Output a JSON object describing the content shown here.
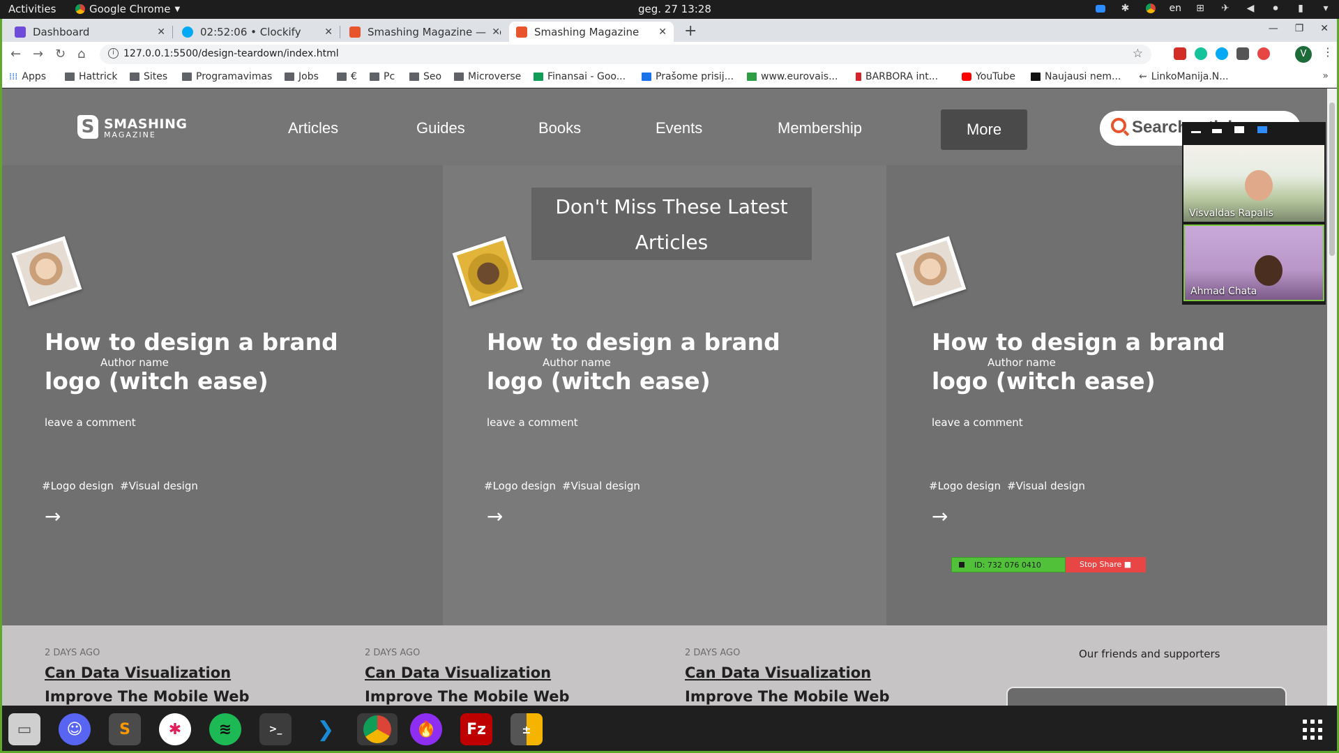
{
  "system": {
    "activities": "Activities",
    "app_name": "Google Chrome",
    "clock": "geg. 27  13:28",
    "lang": "en"
  },
  "tabs": [
    {
      "title": "Dashboard",
      "favicon_color": "#6e4bd8"
    },
    {
      "title": "02:52:06 • Clockify",
      "favicon_color": "#03a9f4"
    },
    {
      "title": "Smashing Magazine — Fo",
      "favicon_color": "#e8542c"
    },
    {
      "title": "Smashing Magazine",
      "favicon_color": "#e8542c"
    }
  ],
  "toolbar": {
    "url": "127.0.0.1:5500/design-teardown/index.html",
    "profile_initial": "V"
  },
  "bookmarks": [
    "Apps",
    "Hattrick",
    "Sites",
    "Programavimas",
    "Jobs",
    "€",
    "Pc",
    "Seo",
    "Microverse",
    "Finansai - Goo...",
    "Prašome prisij...",
    "www.eurovais...",
    "BARBORA int...",
    "YouTube",
    "Naujausi nem...",
    "LinkoManija.N..."
  ],
  "site": {
    "logo_line1": "SMASHING",
    "logo_line2": "MAGAZINE",
    "logo_mark": "S",
    "nav": [
      "Articles",
      "Guides",
      "Books",
      "Events",
      "Membership"
    ],
    "nav_more": "More",
    "search_placeholder": "Search articles",
    "latest_heading_line1": "Don't Miss These Latest",
    "latest_heading_line2": "Articles",
    "cards": [
      {
        "author": "Author name",
        "title": "How to design a brand logo (witch ease)",
        "comment": "leave a comment",
        "tags": [
          "#Logo design",
          "#Visual design"
        ],
        "arrow": "→"
      },
      {
        "author": "Author name",
        "title": "How to design a brand logo (witch ease)",
        "comment": "leave a comment",
        "tags": [
          "#Logo design",
          "#Visual design"
        ],
        "arrow": "→"
      },
      {
        "author": "Author name",
        "title": "How to design a brand logo (witch ease)",
        "comment": "leave a comment",
        "tags": [
          "#Logo design",
          "#Visual design"
        ],
        "arrow": "→"
      }
    ],
    "recent": [
      {
        "ago": "2 DAYS AGO",
        "title": "Can Data Visualization",
        "title2": "Improve The Mobile Web"
      },
      {
        "ago": "2 DAYS AGO",
        "title": "Can Data Visualization",
        "title2": "Improve The Mobile Web"
      },
      {
        "ago": "2 DAYS AGO",
        "title": "Can Data Visualization",
        "title2": "Improve The Mobile Web"
      }
    ],
    "friends": "Our friends and supporters"
  },
  "zoom": {
    "participant1": "Visvaldas Rapalis",
    "participant2": "Ahmad Chata",
    "meeting_id": "ID: 732 076 0410",
    "stop_share": "Stop Share"
  },
  "colors": {
    "accent": "#e8542c",
    "frame": "#5fa82b"
  }
}
